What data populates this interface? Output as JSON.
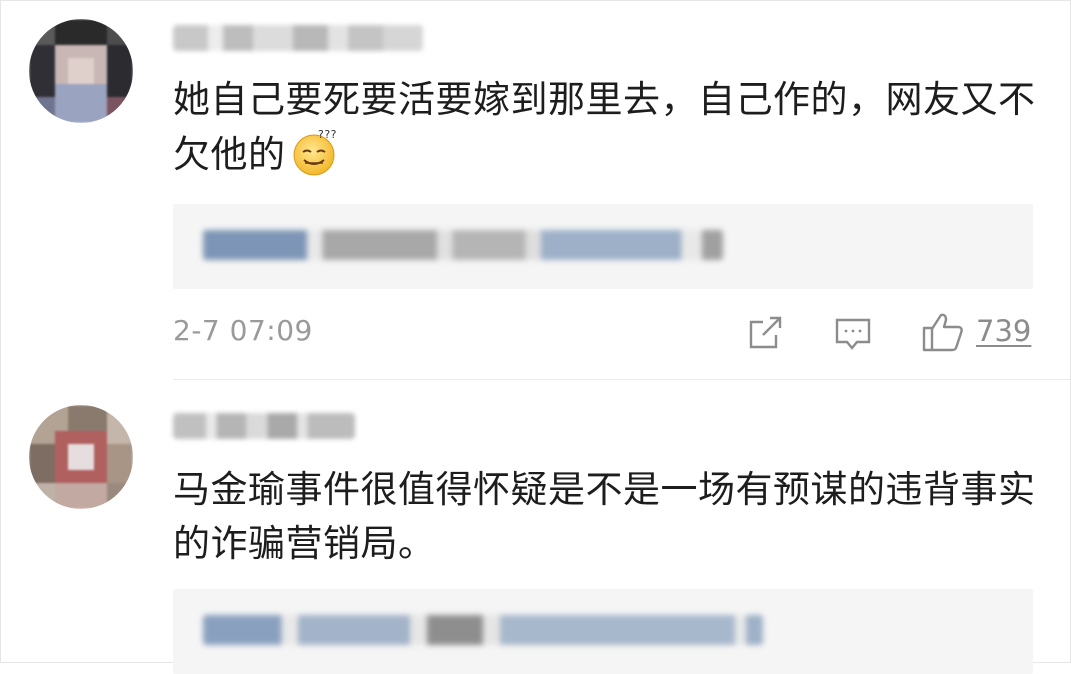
{
  "comments": [
    {
      "text": "她自己要死要活要嫁到那里去，自己作的，网友又不欠他的",
      "emoji": "dizzy-smile-emoji",
      "time": "2-7 07:09",
      "likes": "739"
    },
    {
      "text": "马金瑜事件很值得怀疑是不是一场有预谋的违背事实的诈骗营销局。"
    }
  ],
  "icons": {
    "share": "share-icon",
    "comment": "comment-icon",
    "like": "thumbs-up-icon"
  },
  "colors": {
    "text": "#1d1d1d",
    "meta": "#9a9a9a",
    "reply_bg": "#f5f5f5",
    "blur_link": "#6f8fb5"
  }
}
